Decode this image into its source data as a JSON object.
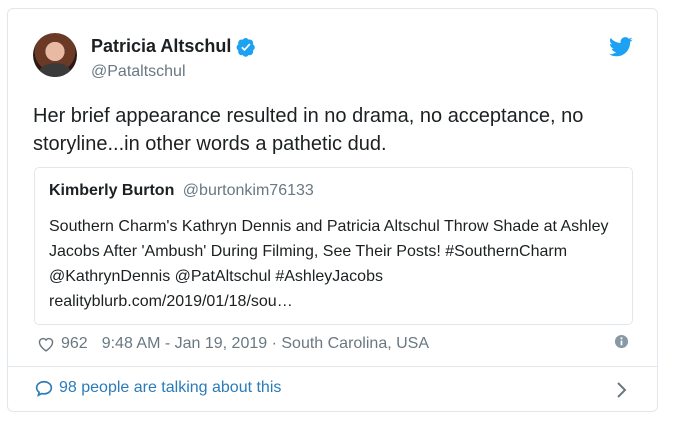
{
  "author": {
    "name": "Patricia Altschul",
    "handle": "@Pataltschul"
  },
  "tweet": {
    "text": "Her brief appearance resulted in no drama, no acceptance, no storyline...in other words a pathetic dud."
  },
  "quoted": {
    "name": "Kimberly Burton",
    "handle": "@burtonkim76133",
    "text": "Southern Charm's Kathryn Dennis and Patricia Altschul Throw Shade at Ashley Jacobs After 'Ambush' During Filming, See Their Posts! #SouthernCharm @KathrynDennis @PatAltschul #AshleyJacobs realityblurb.com/2019/01/18/sou…"
  },
  "meta": {
    "likes": "962",
    "datetime_location": "9:48 AM - Jan 19, 2019 · South Carolina, USA"
  },
  "footer": {
    "talking": "98 people are talking about this"
  },
  "icons": {
    "verified": "verified-badge-icon",
    "bird": "twitter-bird-icon",
    "heart": "heart-icon",
    "info": "info-icon",
    "bubble": "speech-bubble-icon",
    "chevron": "chevron-right-icon"
  },
  "colors": {
    "accent": "#1da1f2",
    "link": "#2b7bb9",
    "muted": "#697882",
    "border": "#e1e8ed"
  }
}
